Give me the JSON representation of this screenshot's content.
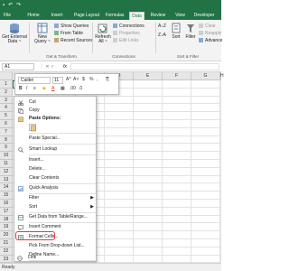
{
  "ribbon": {
    "tabs": [
      "File",
      "Home",
      "Insert",
      "Page Layout",
      "Formulas",
      "Data",
      "Review",
      "View",
      "Developer"
    ],
    "active_tab": "Data",
    "get_external_data": [
      "Get External",
      "Data ~"
    ],
    "new_query": [
      "New",
      "Query ~"
    ],
    "show_queries": "Show Queries",
    "from_table": "From Table",
    "recent_sources": "Recent Sources",
    "get_transform_label": "Get & Transform",
    "refresh": [
      "Refresh",
      "All ~"
    ],
    "connections": "Connections",
    "properties": "Properties",
    "edit_links": "Edit Links",
    "connections_label": "Connections",
    "sort_az": "A↓Z",
    "sort_za": "Z↓A",
    "sort": "Sort",
    "filter": "Filter",
    "clear": "Clear",
    "reapply": "Reapply",
    "advanced": "Advance",
    "sort_filter_label": "Sort & Filter"
  },
  "formula_bar": {
    "name_box": "A1",
    "fx": "fx"
  },
  "grid": {
    "columns": [
      "A",
      "B",
      "C",
      "D",
      "E",
      "F",
      "G",
      "H"
    ],
    "rows": [
      "1",
      "2",
      "3",
      "4",
      "5",
      "6",
      "7",
      "8",
      "9",
      "10",
      "11",
      "12",
      "13",
      "14",
      "15",
      "16",
      "17",
      "18",
      "19",
      "20",
      "21",
      "22",
      "23"
    ]
  },
  "mini_toolbar": {
    "font": "Calibri",
    "size": "11",
    "grow": "A^",
    "shrink": "A˅",
    "currency": "$",
    "percent": "%",
    "comma": ",",
    "format_painter": "⎘",
    "bold": "B",
    "italic": "I",
    "align": "≡",
    "fill": "◆",
    "font_color": "A",
    "borders": "▦",
    "inc_decimal": ".00",
    "dec_decimal": ".0"
  },
  "context_menu": {
    "cut": "Cut",
    "copy": "Copy",
    "paste_options": "Paste Options:",
    "paste_special": "Paste Special...",
    "smart_lookup": "Smart Lookup",
    "insert": "Insert...",
    "delete": "Delete...",
    "clear_contents": "Clear Contents",
    "quick_analysis": "Quick Analysis",
    "filter": "Filter",
    "sort": "Sort",
    "get_data": "Get Data from Table/Range...",
    "insert_comment": "Insert Comment",
    "format_cells": "Format Cells...",
    "pick_dropdown": "Pick From Drop-down List...",
    "define_name": "Define Name...",
    "link": "Link"
  },
  "status_bar": {
    "text": "Ready"
  },
  "colors": {
    "brand": "#217346",
    "highlight_box": "#e03b3b"
  }
}
